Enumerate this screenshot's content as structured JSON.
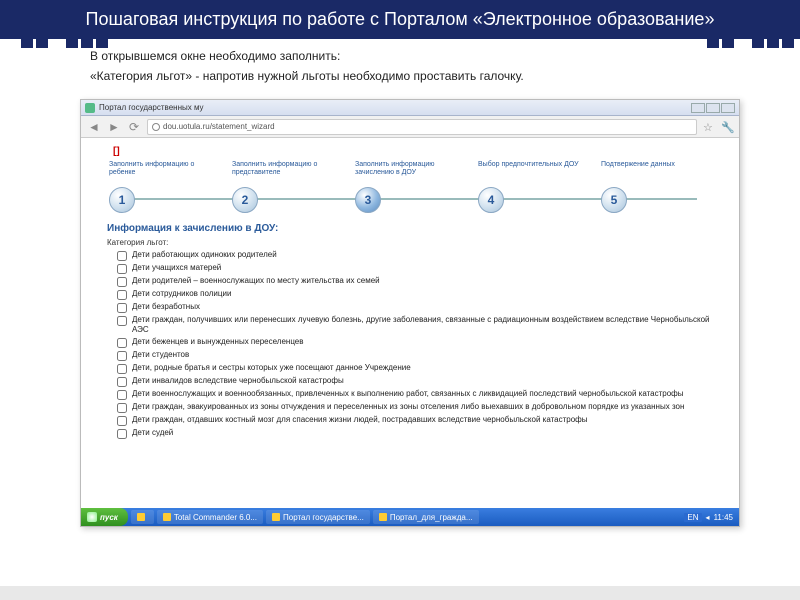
{
  "title": "Пошаговая инструкция по работе с Порталом «Электронное образование»",
  "instr1": "В открывшемся окне необходимо заполнить:",
  "instr2": "«Категория льгот» - напротив нужной льготы необходимо проставить галочку.",
  "window_title": "Портал государственных му",
  "url": "dou.uotula.ru/statement_wizard",
  "red_mark": "[]",
  "steps": [
    {
      "n": "1",
      "label": "Заполнить информацию о ребенке"
    },
    {
      "n": "2",
      "label": "Заполнить информацию о представителе"
    },
    {
      "n": "3",
      "label": "Заполнить информацию зачислению в ДОУ"
    },
    {
      "n": "4",
      "label": "Выбор предпочтительных ДОУ"
    },
    {
      "n": "5",
      "label": "Подтвержение данных"
    }
  ],
  "section_title": "Информация к зачислению в ДОУ:",
  "category_label": "Категория льгот:",
  "checkboxes": [
    "Дети работающих одиноких родителей",
    "Дети учащихся матерей",
    "Дети родителей – военнослужащих по месту жительства их семей",
    "Дети сотрудников полиции",
    "Дети безработных",
    "Дети граждан, получивших или перенесших лучевую болезнь, другие заболевания, связанные с радиационным воздействием вследствие Чернобыльской АЭС",
    "Дети беженцев и вынужденных переселенцев",
    "Дети студентов",
    "Дети, родные братья и сестры которых уже посещают данное Учреждение",
    "Дети инвалидов вследствие чернобыльской катастрофы",
    "Дети военнослужащих и военнообязанных, привлеченных к выполнению работ, связанных с ликвидацией последствий чернобыльской катастрофы",
    "Дети граждан, эвакуированных из зоны отчуждения и переселенных из зоны отселения либо выехавших в добровольном порядке из указанных зон",
    "Дети граждан, отдавших костный мозг для спасения жизни людей, пострадавших вследствие чернобыльской катастрофы",
    "Дети судей"
  ],
  "taskbar": {
    "start": "пуск",
    "items": [
      "",
      "Total Commander 6.0...",
      "Портал государстве...",
      "Портал_для_гражда..."
    ],
    "lang": "EN",
    "time": "11:45"
  }
}
